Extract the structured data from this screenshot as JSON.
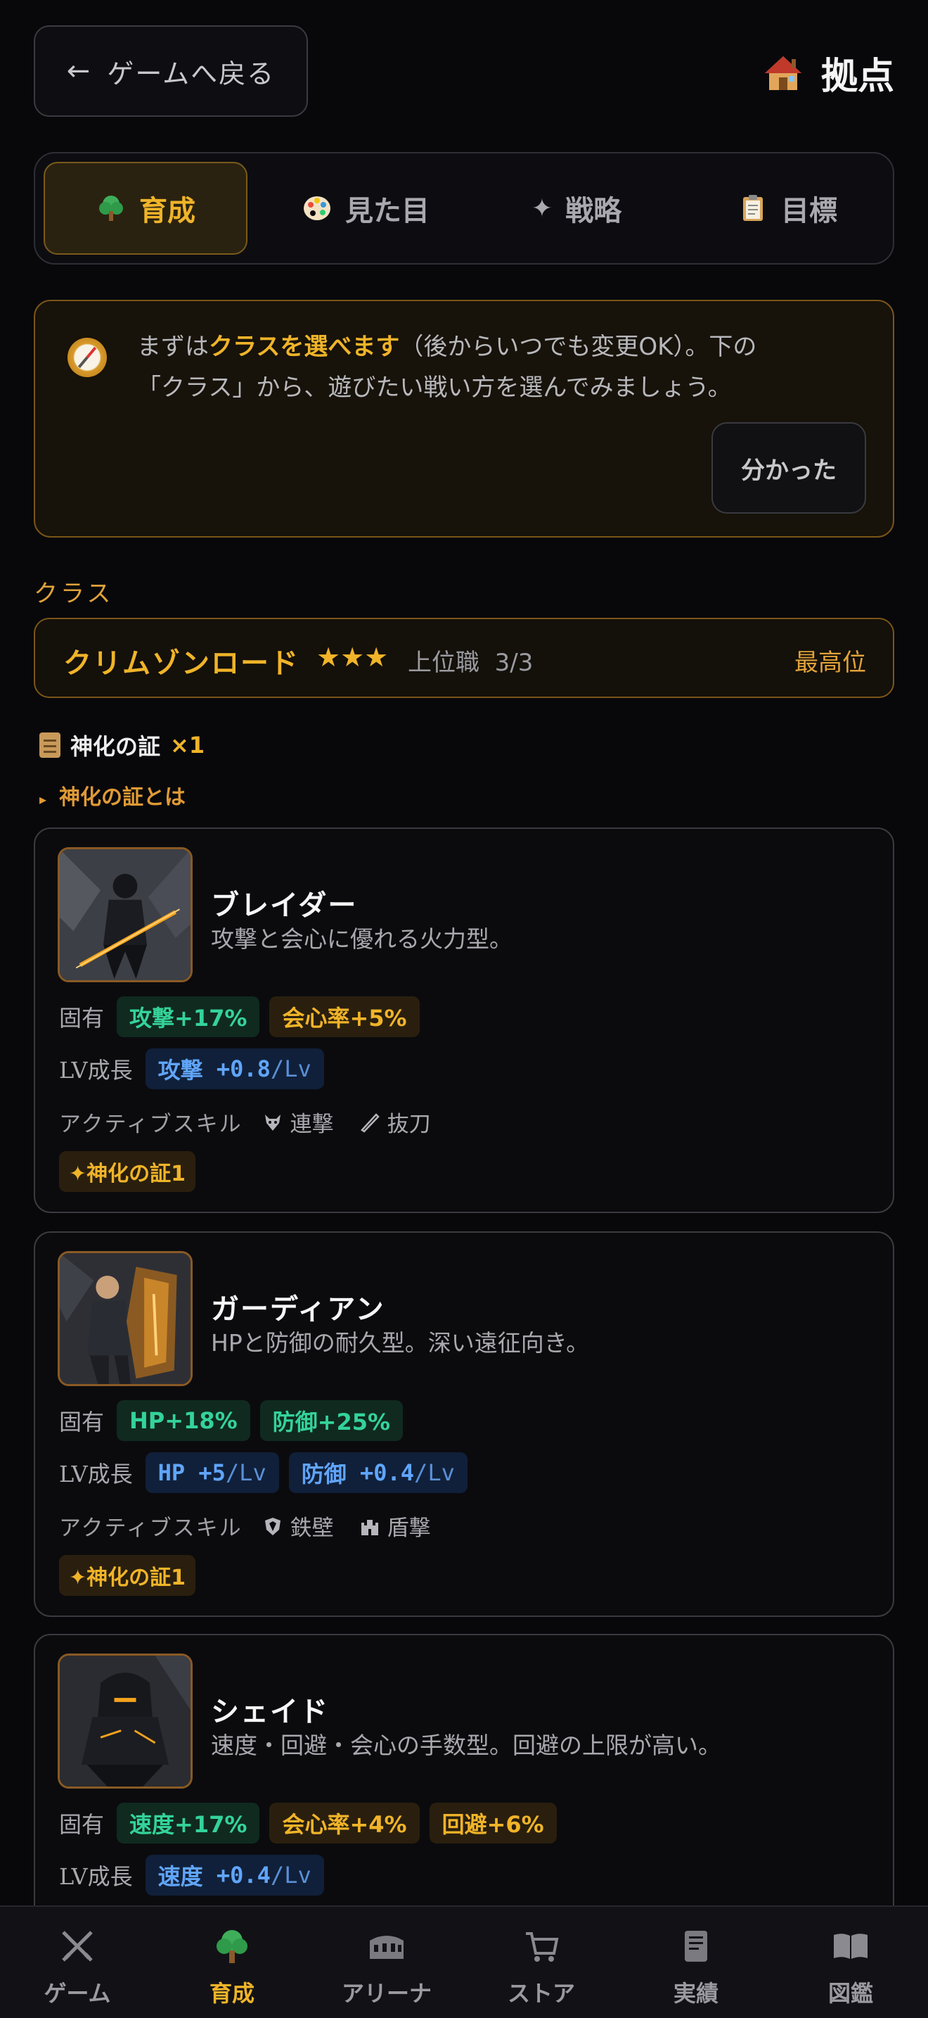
{
  "header": {
    "back_label": "ゲームへ戻る",
    "back_arrow": "←",
    "title": "拠点",
    "title_icon": "house-icon"
  },
  "tabs": [
    {
      "label": "育成",
      "icon": "tree-icon",
      "active": true
    },
    {
      "label": "見た目",
      "icon": "palette-icon",
      "active": false
    },
    {
      "label": "戦略",
      "icon": "sparkle-icon",
      "active": false
    },
    {
      "label": "目標",
      "icon": "clipboard-icon",
      "active": false
    }
  ],
  "hint": {
    "prefix": "まずは",
    "highlight": "クラスを選べます",
    "line1_rest": "（後からいつでも変更OK）。下の",
    "line2": "「クラス」から、遊びたい戦い方を選んでみましょう。",
    "ok_label": "分かった"
  },
  "class_section": {
    "label": "クラス",
    "current_name": "クリムゾンロード",
    "stars": "★★★",
    "tier": "上位職",
    "progress": "3/3",
    "max_label": "最高位"
  },
  "certificate": {
    "label": "神化の証",
    "count": "×1",
    "help": "神化の証とは",
    "help_marker": "▸"
  },
  "row_labels": {
    "innate": "固有",
    "growth": "LV成長",
    "skill": "アクティブスキル"
  },
  "cards": [
    {
      "name": "ブレイダー",
      "desc": "攻撃と会心に優れる火力型。",
      "innate": [
        {
          "text": "攻撃+17%",
          "tone": "green"
        },
        {
          "text": "会心率+5%",
          "tone": "gold"
        }
      ],
      "growth": [
        {
          "stat": "攻撃",
          "value": "+0.8",
          "unit": "/Lv"
        }
      ],
      "skills": [
        {
          "name": "連撃",
          "icon": "wolf-icon"
        },
        {
          "name": "抜刀",
          "icon": "blade-icon"
        }
      ],
      "badge": "✦神化の証1"
    },
    {
      "name": "ガーディアン",
      "desc": "HPと防御の耐久型。深い遠征向き。",
      "innate": [
        {
          "text": "HP+18%",
          "tone": "green"
        },
        {
          "text": "防御+25%",
          "tone": "green"
        }
      ],
      "growth": [
        {
          "stat": "HP",
          "value": "+5",
          "unit": "/Lv"
        },
        {
          "stat": "防御",
          "value": "+0.4",
          "unit": "/Lv"
        }
      ],
      "skills": [
        {
          "name": "鉄壁",
          "icon": "shield-icon"
        },
        {
          "name": "盾撃",
          "icon": "castle-icon"
        }
      ],
      "badge": "✦神化の証1"
    },
    {
      "name": "シェイド",
      "desc": "速度・回避・会心の手数型。回避の上限が高い。",
      "innate": [
        {
          "text": "速度+17%",
          "tone": "green"
        },
        {
          "text": "会心率+4%",
          "tone": "gold"
        },
        {
          "text": "回避+6%",
          "tone": "gold"
        }
      ],
      "growth": [
        {
          "stat": "速度",
          "value": "+0.4",
          "unit": "/Lv"
        }
      ]
    }
  ],
  "nav": [
    {
      "label": "ゲーム",
      "icon": "crossed-swords-icon",
      "active": false
    },
    {
      "label": "育成",
      "icon": "tree-icon",
      "active": true
    },
    {
      "label": "アリーナ",
      "icon": "colosseum-icon",
      "active": false
    },
    {
      "label": "ストア",
      "icon": "cart-icon",
      "active": false
    },
    {
      "label": "実績",
      "icon": "scroll-icon",
      "active": false
    },
    {
      "label": "図鑑",
      "icon": "book-icon",
      "active": false
    }
  ],
  "colors": {
    "accent": "#f0b429",
    "green": "#34d399",
    "blue": "#60a5fa",
    "background": "#08080b"
  }
}
